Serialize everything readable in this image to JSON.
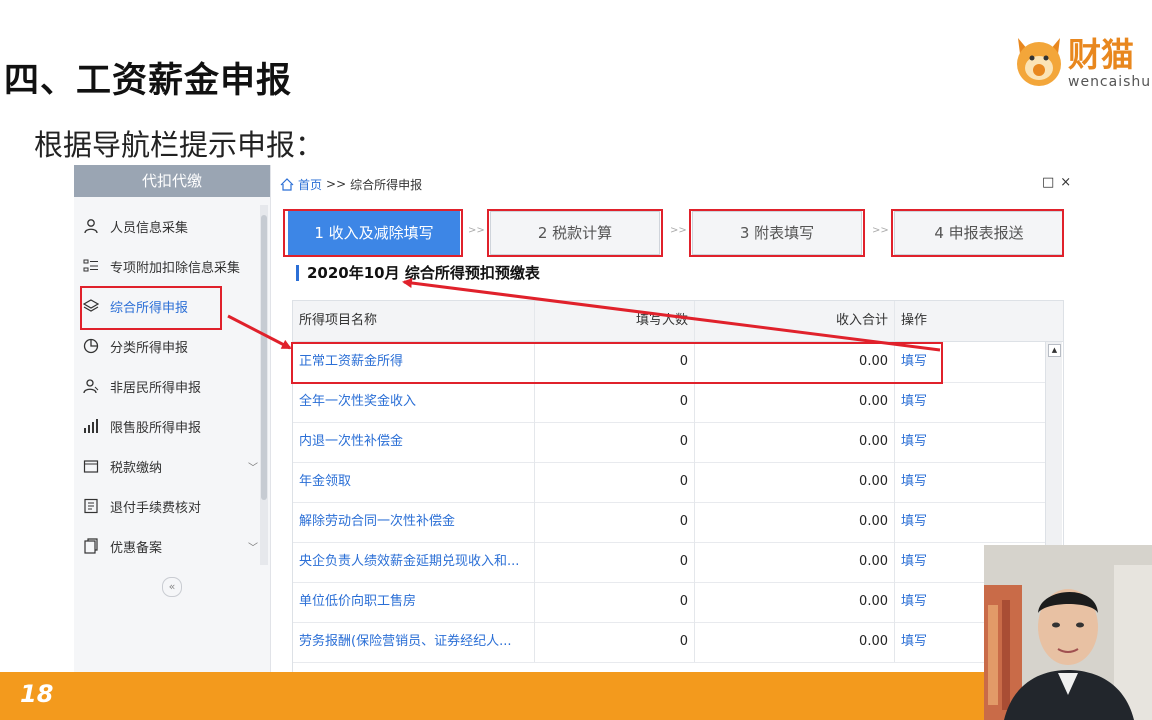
{
  "slide": {
    "title": "四、工资薪金申报",
    "subtitle": "根据导航栏提示申报：",
    "page_number": "18"
  },
  "logo": {
    "name": "财猫",
    "sub": "wencaishu",
    "brand_color": "#e8871e"
  },
  "app": {
    "sidebar": {
      "header": "代扣代缴",
      "items": [
        {
          "label": "人员信息采集",
          "icon": "user-icon"
        },
        {
          "label": "专项附加扣除信息采集",
          "icon": "list-icon"
        },
        {
          "label": "综合所得申报",
          "icon": "layers-icon",
          "active": true
        },
        {
          "label": "分类所得申报",
          "icon": "pie-icon"
        },
        {
          "label": "非居民所得申报",
          "icon": "person-icon"
        },
        {
          "label": "限售股所得申报",
          "icon": "bar-chart-icon"
        },
        {
          "label": "税款缴纳",
          "icon": "wallet-icon",
          "expandable": true
        },
        {
          "label": "退付手续费核对",
          "icon": "document-icon"
        },
        {
          "label": "优惠备案",
          "icon": "copy-icon",
          "expandable": true
        }
      ],
      "collapse_symbol": "«"
    },
    "breadcrumb": {
      "home": "首页",
      "sep": ">>",
      "current": "综合所得申报"
    },
    "window_controls": {
      "restore": "□",
      "close": "×"
    },
    "steps": [
      {
        "label": "1 收入及减除填写",
        "active": true
      },
      {
        "label": "2 税款计算",
        "active": false
      },
      {
        "label": "3 附表填写",
        "active": false
      },
      {
        "label": "4 申报表报送",
        "active": false
      }
    ],
    "step_separator": ">>",
    "section_title": "2020年10月  综合所得预扣预缴表",
    "table": {
      "headers": [
        "所得项目名称",
        "填写人数",
        "收入合计",
        "操作"
      ],
      "rows": [
        {
          "name": "正常工资薪金所得",
          "count": "0",
          "income": "0.00",
          "action": "填写"
        },
        {
          "name": "全年一次性奖金收入",
          "count": "0",
          "income": "0.00",
          "action": "填写"
        },
        {
          "name": "内退一次性补偿金",
          "count": "0",
          "income": "0.00",
          "action": "填写"
        },
        {
          "name": "年金领取",
          "count": "0",
          "income": "0.00",
          "action": "填写"
        },
        {
          "name": "解除劳动合同一次性补偿金",
          "count": "0",
          "income": "0.00",
          "action": "填写"
        },
        {
          "name": "央企负责人绩效薪金延期兑现收入和...",
          "count": "0",
          "income": "0.00",
          "action": "填写"
        },
        {
          "name": "单位低价向职工售房",
          "count": "0",
          "income": "0.00",
          "action": "填写"
        },
        {
          "name": "劳务报酬(保险营销员、证券经纪人...",
          "count": "0",
          "income": "0.00",
          "action": "填写"
        }
      ]
    }
  },
  "colors": {
    "accent_blue": "#3d86e6",
    "highlight_red": "#e0212b",
    "footer_orange": "#f39a1d"
  }
}
